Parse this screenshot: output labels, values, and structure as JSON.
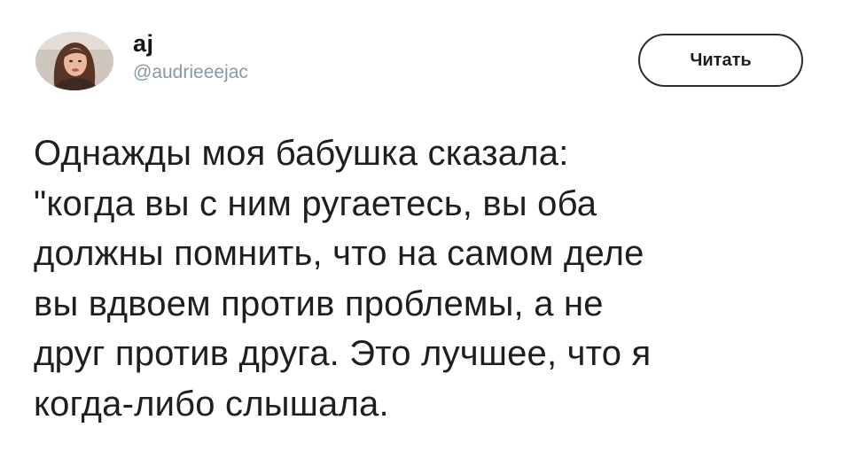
{
  "user": {
    "display_name": "aj",
    "handle": "@audrieeejac",
    "avatar_icon": "user-avatar-photo"
  },
  "follow_button": {
    "label": "Читать"
  },
  "tweet": {
    "text": "Однажды моя бабушка сказала:\n\"когда вы с ним ругаетесь, вы оба\nдолжны помнить, что на самом деле\nвы вдвоем против проблемы, а не\nдруг против друга. Это лучшее, что я\nкогда-либо слышала."
  }
}
